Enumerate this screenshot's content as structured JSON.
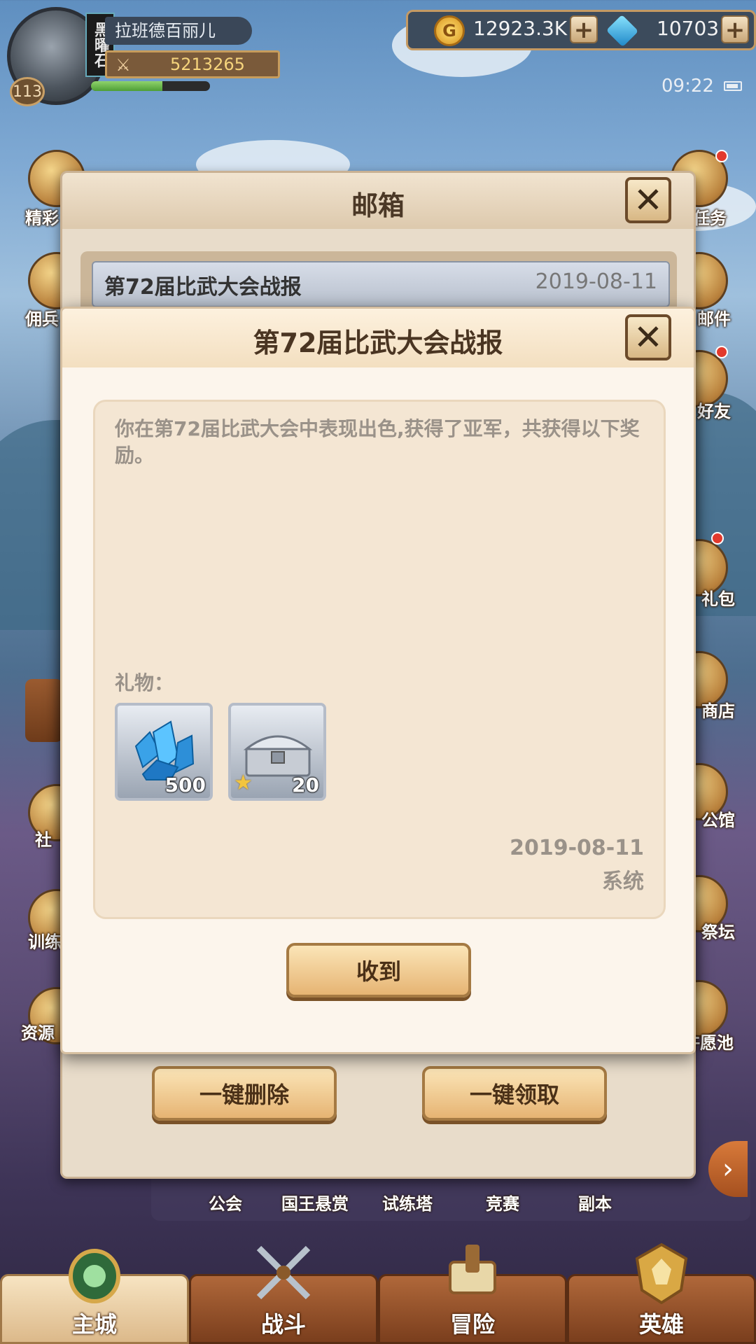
{
  "hud": {
    "player_name": "拉班德百丽儿",
    "rank_tag": "黑曜石",
    "level": "113",
    "power": "5213265",
    "gold": "12923.3K",
    "gems": "10703",
    "plus_label": "+",
    "time": "09:22"
  },
  "side_left": [
    "精彩",
    "佣兵",
    "社",
    "训练",
    "资源"
  ],
  "side_right": [
    "任务",
    "邮件",
    "好友",
    "礼包",
    "商店",
    "公馆",
    "祭坛",
    "许愿池"
  ],
  "features": [
    "公会",
    "国王悬赏",
    "试练塔",
    "竞赛",
    "副本"
  ],
  "mailbox": {
    "title": "邮箱",
    "item_title": "第72届比武大会战报",
    "item_date": "2019-08-11",
    "delete_all": "一键删除",
    "claim_all": "一键领取"
  },
  "report": {
    "title": "第72届比武大会战报",
    "body": "你在第72届比武大会中表现出色,获得了亚军，共获得以下奖励。",
    "gift_label": "礼物：",
    "items": [
      {
        "name": "crystal",
        "count": "500"
      },
      {
        "name": "silver-chest",
        "count": "20"
      }
    ],
    "date": "2019-08-11",
    "sender": "系统",
    "confirm": "收到"
  },
  "bottom_nav": [
    "主城",
    "战斗",
    "冒险",
    "英雄"
  ]
}
